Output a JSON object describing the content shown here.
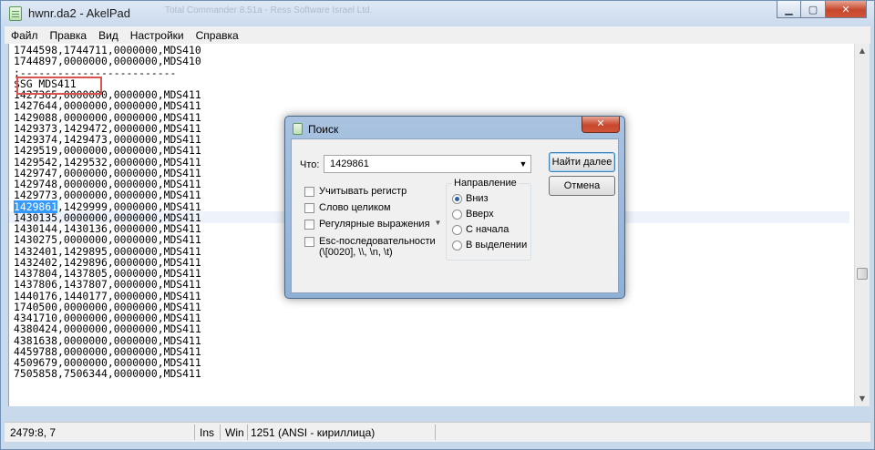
{
  "window": {
    "title": "hwnr.da2 - AkelPad",
    "background_title": "Total Commander 8.51a - Ress Software Israel Ltd.",
    "controls": {
      "minimize": "▁",
      "maximize": "▢",
      "close": "✕"
    }
  },
  "menu": [
    "Файл",
    "Правка",
    "Вид",
    "Настройки",
    "Справка"
  ],
  "editor": {
    "lines": [
      "1744598,1744711,0000000,MDS410",
      "1744897,0000000,0000000,MDS410",
      ";-------------------------",
      "$SG MDS411",
      "1427365,0000000,0000000,MDS411",
      "1427644,0000000,0000000,MDS411",
      "1429088,0000000,0000000,MDS411",
      "1429373,1429472,0000000,MDS411",
      "1429374,1429473,0000000,MDS411",
      "1429519,0000000,0000000,MDS411",
      "1429542,1429532,0000000,MDS411",
      "1429747,0000000,0000000,MDS411",
      "1429748,0000000,0000000,MDS411",
      "1429773,0000000,0000000,MDS411",
      "1429861,1429999,0000000,MDS411",
      "1430135,0000000,0000000,MDS411",
      "1430144,1430136,0000000,MDS411",
      "1430275,0000000,0000000,MDS411",
      "1432401,1429895,0000000,MDS411",
      "1432402,1429896,0000000,MDS411",
      "1437804,1437805,0000000,MDS411",
      "1437806,1437807,0000000,MDS411",
      "1440176,1440177,0000000,MDS411",
      "1740500,0000000,0000000,MDS411",
      "4341710,0000000,0000000,MDS411",
      "4380424,0000000,0000000,MDS411",
      "4381638,0000000,0000000,MDS411",
      "4459788,0000000,0000000,MDS411",
      "4509679,0000000,0000000,MDS411",
      "7505858,7506344,0000000,MDS411"
    ],
    "selected_line_index": 14,
    "selected_text": "1429861",
    "highlight_color": "#3399ff",
    "marker_color": "#d9534f"
  },
  "status": {
    "position": "2479:8, 7",
    "insert_mode": "Ins",
    "newline": "Win",
    "codepage": "1251  (ANSI - кириллица)"
  },
  "find_dialog": {
    "title": "Поиск",
    "what_label": "Что:",
    "what_value": "1429861",
    "find_next_label": "Найти далее",
    "cancel_label": "Отмена",
    "options": {
      "match_case": "Учитывать регистр",
      "whole_word": "Слово целиком",
      "regex": "Регулярные выражения",
      "escape": "Esc-последовательности",
      "escape_hint": "(\\[0020], \\\\, \\n, \\t)"
    },
    "direction": {
      "title": "Направление",
      "down": "Вниз",
      "up": "Вверх",
      "from_start": "С начала",
      "in_selection": "В выделении",
      "selected": "down"
    }
  }
}
